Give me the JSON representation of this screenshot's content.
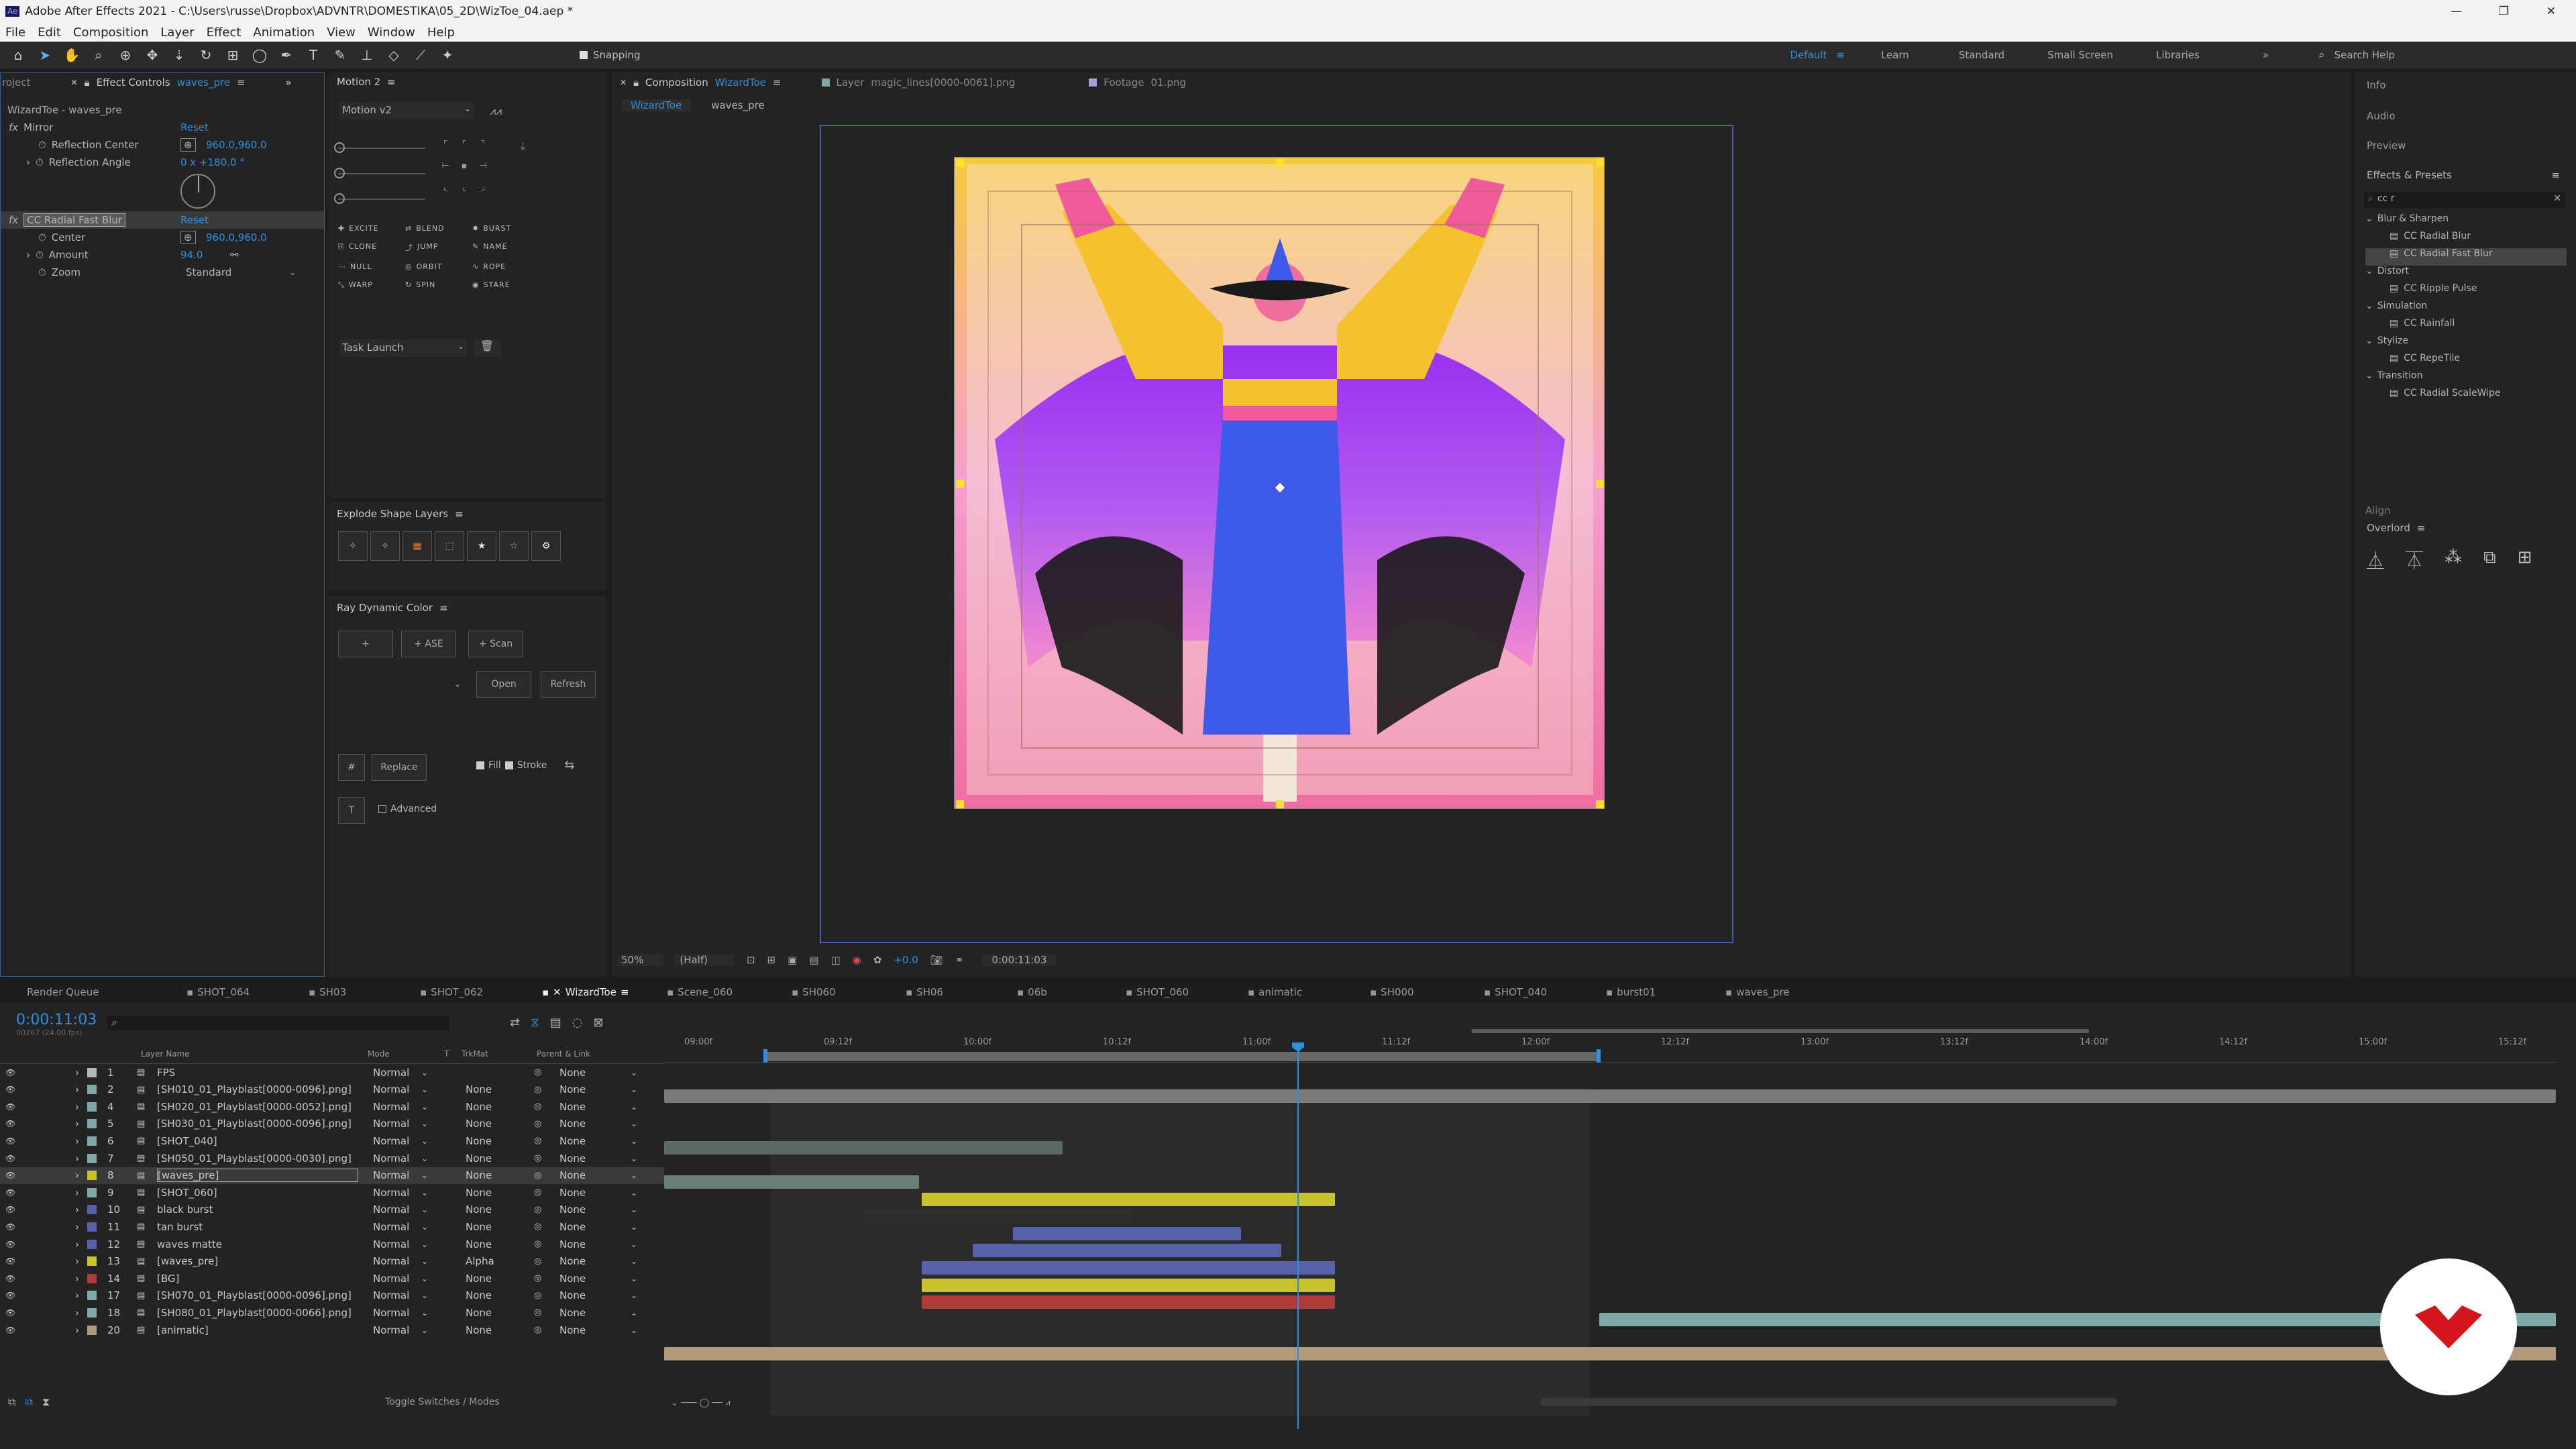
{
  "app": {
    "title": "Adobe After Effects 2021 - C:\\Users\\russe\\Dropbox\\ADVNTR\\DOMESTIKA\\05_2D\\WizToe_04.aep *",
    "menu": [
      "File",
      "Edit",
      "Composition",
      "Layer",
      "Effect",
      "Animation",
      "View",
      "Window",
      "Help"
    ]
  },
  "toolbar": {
    "snapping": "Snapping",
    "workspaces": [
      "Default",
      "Learn",
      "Standard",
      "Small Screen",
      "Libraries"
    ],
    "search": "Search Help"
  },
  "effects": {
    "tab_project": "roject",
    "tab": "Effect Controls",
    "tab_layer": "waves_pre",
    "subtitle": "WizardToe - waves_pre",
    "mirror": {
      "name": "Mirror",
      "reset": "Reset",
      "center_label": "Reflection Center",
      "center_val": "960.0,960.0",
      "angle_label": "Reflection Angle",
      "angle_val": "0 x +180.0 °"
    },
    "blur": {
      "name": "CC Radial Fast Blur",
      "reset": "Reset",
      "center_label": "Center",
      "center_val": "960.0,960.0",
      "amount_label": "Amount",
      "amount_val": "94.0",
      "zoom_label": "Zoom",
      "zoom_val": "Standard"
    }
  },
  "motion": {
    "title": "Motion 2",
    "version": "Motion v2",
    "tools": [
      "EXCITE",
      "BLEND",
      "BURST",
      "CLONE",
      "JUMP",
      "NAME",
      "NULL",
      "ORBIT",
      "ROPE",
      "WARP",
      "SPIN",
      "STARE"
    ],
    "task": "Task Launch"
  },
  "explode": {
    "title": "Explode Shape Layers"
  },
  "ray": {
    "title": "Ray Dynamic Color",
    "plus": "+",
    "ase": "+ ASE",
    "scan": "+ Scan",
    "open": "Open",
    "refresh": "Refresh",
    "hash": "#",
    "replace": "Replace",
    "fill": "Fill",
    "stroke": "Stroke",
    "t": "T",
    "advanced": "Advanced"
  },
  "comp": {
    "tab": "Composition",
    "tab_name": "WizardToe",
    "layer_tab": "Layer",
    "layer_name": "magic_lines[0000-0061].png",
    "footage_tab": "Footage",
    "footage_name": "01.png",
    "crumb1": "WizardToe",
    "crumb2": "waves_pre",
    "zoom": "50%",
    "res": "(Half)",
    "exposure": "+0.0",
    "time": "0:00:11:03"
  },
  "right": {
    "info": "Info",
    "audio": "Audio",
    "preview": "Preview",
    "effects": "Effects & Presets",
    "search": "cc r",
    "tree": [
      {
        "cat": "Blur & Sharpen",
        "items": [
          "CC Radial Blur",
          "CC Radial Fast Blur"
        ]
      },
      {
        "cat": "Distort",
        "items": [
          "CC Ripple Pulse"
        ]
      },
      {
        "cat": "Simulation",
        "items": [
          "CC Rainfall"
        ]
      },
      {
        "cat": "Stylize",
        "items": [
          "CC RepeTile"
        ]
      },
      {
        "cat": "Transition",
        "items": [
          "CC Radial ScaleWipe"
        ]
      }
    ],
    "align": "Align",
    "overlord": "Overlord"
  },
  "timeline": {
    "tabs": [
      "Render Queue",
      "SHOT_064",
      "SH03",
      "SHOT_062",
      "WizardToe",
      "Scene_060",
      "SH060",
      "SH06",
      "06b",
      "SHOT_060",
      "animatic",
      "SH000",
      "SHOT_040",
      "burst01",
      "waves_pre"
    ],
    "time": "0:00:11:03",
    "fps": "00267 (24.00 fps)",
    "cols": {
      "name": "Layer Name",
      "mode": "Mode",
      "t": "T",
      "trk": "TrkMat",
      "parent": "Parent & Link"
    },
    "ruler": [
      "09:00f",
      "09:12f",
      "10:00f",
      "10:12f",
      "11:00f",
      "11:12f",
      "12:00f",
      "12:12f",
      "13:00f",
      "13:12f",
      "14:00f",
      "14:12f",
      "15:00f",
      "15:12f"
    ],
    "layers": [
      {
        "n": "1",
        "name": "FPS",
        "color": "#b5b5b5",
        "mode": "Normal",
        "trk": "",
        "parent": "None"
      },
      {
        "n": "2",
        "name": "[SH010_01_Playblast[0000-0096].png]",
        "color": "#7fa8a8",
        "mode": "Normal",
        "trk": "None",
        "parent": "None"
      },
      {
        "n": "4",
        "name": "[SH020_01_Playblast[0000-0052].png]",
        "color": "#7fa8a8",
        "mode": "Normal",
        "trk": "None",
        "parent": "None"
      },
      {
        "n": "5",
        "name": "[SH030_01_Playblast[0000-0096].png]",
        "color": "#7fa8a8",
        "mode": "Normal",
        "trk": "None",
        "parent": "None"
      },
      {
        "n": "6",
        "name": "[SHOT_040]",
        "color": "#7fa8a8",
        "mode": "Normal",
        "trk": "None",
        "parent": "None"
      },
      {
        "n": "7",
        "name": "[SH050_01_Playblast[0000-0030].png]",
        "color": "#7fa8a8",
        "mode": "Normal",
        "trk": "None",
        "parent": "None"
      },
      {
        "n": "8",
        "name": "[waves_pre]",
        "color": "#c9c22f",
        "mode": "Normal",
        "trk": "None",
        "parent": "None"
      },
      {
        "n": "9",
        "name": "[SHOT_060]",
        "color": "#7fa8a8",
        "mode": "Normal",
        "trk": "None",
        "parent": "None"
      },
      {
        "n": "10",
        "name": "black burst",
        "color": "#5561a8",
        "mode": "Normal",
        "trk": "None",
        "parent": "None"
      },
      {
        "n": "11",
        "name": "tan burst",
        "color": "#5561a8",
        "mode": "Normal",
        "trk": "None",
        "parent": "None"
      },
      {
        "n": "12",
        "name": "waves matte",
        "color": "#5561a8",
        "mode": "Normal",
        "trk": "None",
        "parent": "None"
      },
      {
        "n": "13",
        "name": "[waves_pre]",
        "color": "#c9c22f",
        "mode": "Normal",
        "trk": "Alpha",
        "parent": "None"
      },
      {
        "n": "14",
        "name": "[BG]",
        "color": "#b03a3a",
        "mode": "Normal",
        "trk": "None",
        "parent": "None"
      },
      {
        "n": "17",
        "name": "[SH070_01_Playblast[0000-0096].png]",
        "color": "#7fa8a8",
        "mode": "Normal",
        "trk": "None",
        "parent": "None"
      },
      {
        "n": "18",
        "name": "[SH080_01_Playblast[0000-0066].png]",
        "color": "#7fa8a8",
        "mode": "Normal",
        "trk": "None",
        "parent": "None"
      },
      {
        "n": "20",
        "name": "[animatic]",
        "color": "#b09a7a",
        "mode": "Normal",
        "trk": "None",
        "parent": "None"
      }
    ],
    "toggle": "Toggle Switches / Modes"
  },
  "colors": {
    "accent": "#2e8fe0",
    "yellow": "#c9c22f",
    "blue": "#5561a8",
    "teal": "#7fa8a8",
    "red": "#b03a3a"
  }
}
